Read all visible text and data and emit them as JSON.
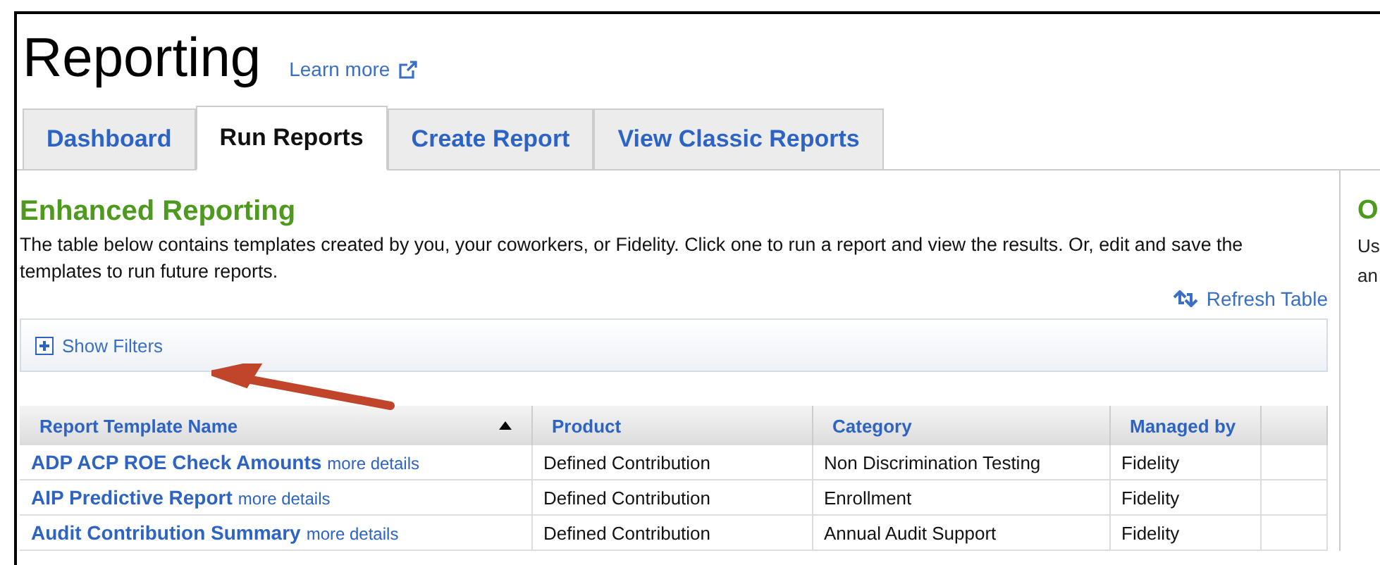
{
  "page": {
    "title": "Reporting",
    "learn_more": "Learn more"
  },
  "tabs": [
    {
      "label": "Dashboard",
      "selected": false
    },
    {
      "label": "Run Reports",
      "selected": true
    },
    {
      "label": "Create Report",
      "selected": false
    },
    {
      "label": "View Classic Reports",
      "selected": false
    }
  ],
  "section": {
    "title": "Enhanced Reporting",
    "description": "The table below contains templates created by you, your coworkers, or Fidelity. Click one to run a report and view the results. Or, edit and save the templates to run future reports.",
    "refresh": "Refresh Table",
    "show_filters": "Show Filters"
  },
  "table": {
    "columns": [
      {
        "label": "Report Template Name",
        "sorted": true
      },
      {
        "label": "Product",
        "sorted": false
      },
      {
        "label": "Category",
        "sorted": false
      },
      {
        "label": "Managed by",
        "sorted": false
      }
    ],
    "rows": [
      {
        "name": "ADP ACP ROE Check Amounts",
        "more": "more details",
        "product": "Defined Contribution",
        "category": "Non Discrimination Testing",
        "managed_by": "Fidelity"
      },
      {
        "name": "AIP Predictive Report",
        "more": "more details",
        "product": "Defined Contribution",
        "category": "Enrollment",
        "managed_by": "Fidelity"
      },
      {
        "name": "Audit Contribution Summary",
        "more": "more details",
        "product": "Defined Contribution",
        "category": "Annual Audit Support",
        "managed_by": "Fidelity"
      }
    ]
  },
  "side_panel": {
    "title": "O",
    "lines": [
      "Us",
      "an"
    ]
  }
}
